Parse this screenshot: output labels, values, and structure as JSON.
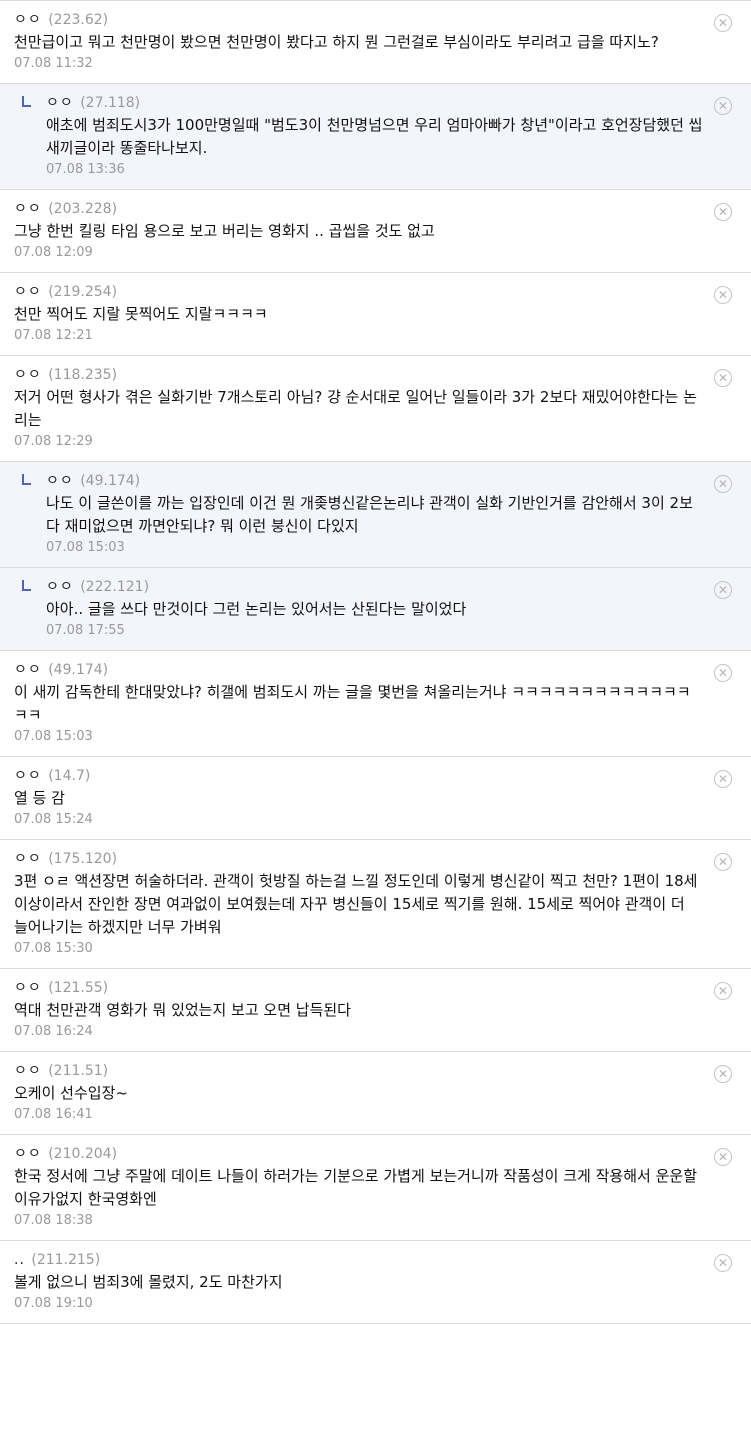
{
  "comments": [
    {
      "reply": false,
      "nick": "ㅇㅇ",
      "ip": "(223.62)",
      "text": "천만급이고 뭐고 천만명이 봤으면 천만명이 봤다고 하지 뭔 그런걸로 부심이라도 부리려고 급을 따지노?",
      "date": "07.08 11:32"
    },
    {
      "reply": true,
      "nick": "ㅇㅇ",
      "ip": "(27.118)",
      "text": "애초에 범죄도시3가 100만명일때 \"범도3이 천만명넘으면 우리 엄마아빠가 창년\"이라고 호언장담했던 씹새끼글이라 똥줄타나보지.",
      "date": "07.08 13:36"
    },
    {
      "reply": false,
      "nick": "ㅇㅇ",
      "ip": "(203.228)",
      "text": "그냥 한번 킬링 타임 용으로 보고 버리는 영화지 .. 곱씹을 것도 없고",
      "date": "07.08 12:09"
    },
    {
      "reply": false,
      "nick": "ㅇㅇ",
      "ip": "(219.254)",
      "text": "천만 찍어도 지랄 못찍어도 지랄ㅋㅋㅋㅋ",
      "date": "07.08 12:21"
    },
    {
      "reply": false,
      "nick": "ㅇㅇ",
      "ip": "(118.235)",
      "text": "저거 어떤 형사가 겪은 실화기반 7개스토리 아님? 걍 순서대로 일어난 일들이라 3가 2보다 재밌어야한다는 논리는",
      "date": "07.08 12:29"
    },
    {
      "reply": true,
      "nick": "ㅇㅇ",
      "ip": "(49.174)",
      "text": "나도 이 글쓴이를 까는 입장인데 이건 뭔 개좆병신같은논리냐 관객이 실화 기반인거를 감안해서 3이 2보다 재미없으면 까면안되냐? 뭐 이런 붕신이 다있지",
      "date": "07.08 15:03"
    },
    {
      "reply": true,
      "nick": "ㅇㅇ",
      "ip": "(222.121)",
      "text": "아아.. 글을 쓰다 만것이다 그런 논리는 있어서는 산된다는 말이었다",
      "date": "07.08 17:55"
    },
    {
      "reply": false,
      "nick": "ㅇㅇ",
      "ip": "(49.174)",
      "text": "이 새끼 감독한테 한대맞았냐? 히갤에 범죄도시 까는 글을 몇번을 쳐올리는거냐 ㅋㅋㅋㅋㅋㅋㅋㅋㅋㅋㅋㅋㅋㅋㅋ",
      "date": "07.08 15:03"
    },
    {
      "reply": false,
      "nick": "ㅇㅇ",
      "ip": "(14.7)",
      "text": "열 등 감",
      "date": "07.08 15:24"
    },
    {
      "reply": false,
      "nick": "ㅇㅇ",
      "ip": "(175.120)",
      "text": "3편 ㅇㄹ 액션장면 허술하더라. 관객이 헛방질 하는걸 느낄 정도인데 이렇게 병신같이 찍고 천만? 1편이 18세 이상이라서 잔인한 장면 여과없이 보여줬는데 자꾸 병신들이 15세로 찍기를 원해. 15세로 찍어야 관객이 더 늘어나기는 하겠지만 너무 가벼워",
      "date": "07.08 15:30"
    },
    {
      "reply": false,
      "nick": "ㅇㅇ",
      "ip": "(121.55)",
      "text": "역대 천만관객 영화가 뭐 있었는지 보고 오면 납득된다",
      "date": "07.08 16:24"
    },
    {
      "reply": false,
      "nick": "ㅇㅇ",
      "ip": "(211.51)",
      "text": "오케이 선수입장~",
      "date": "07.08 16:41"
    },
    {
      "reply": false,
      "nick": "ㅇㅇ",
      "ip": "(210.204)",
      "text": "한국 정서에 그냥 주말에 데이트 나들이 하러가는 기분으로 가볍게 보는거니까 작품성이 크게 작용해서 운운할이유가없지 한국영화엔",
      "date": "07.08 18:38"
    },
    {
      "reply": false,
      "nick": "..",
      "ip": "(211.215)",
      "text": "볼게 없으니 범죄3에 몰렸지, 2도 마찬가지",
      "date": "07.08 19:10"
    }
  ],
  "delete_icon": {
    "name": "close-circle-icon",
    "glyph": "✕",
    "color": "#b4b4b4"
  },
  "colors": {
    "reply_background": "#f3f5fb",
    "reply_mark": "#4a66b5",
    "divider": "#dcdcdc",
    "muted_text": "#999999"
  }
}
